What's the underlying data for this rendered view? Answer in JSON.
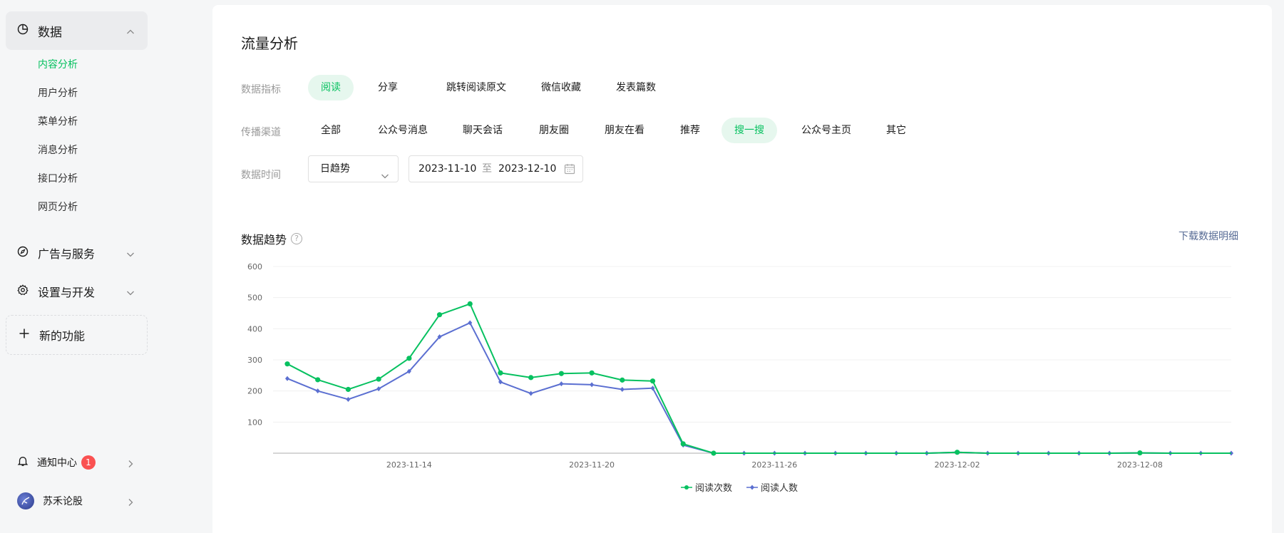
{
  "sidebar": {
    "data_label": "数据",
    "sub_items": [
      "内容分析",
      "用户分析",
      "菜单分析",
      "消息分析",
      "接口分析",
      "网页分析"
    ],
    "ads_label": "广告与服务",
    "settings_label": "设置与开发",
    "new_label": "新的功能",
    "notify_label": "通知中心",
    "notify_count": "1",
    "account_label": "苏禾论股"
  },
  "main": {
    "title": "流量分析",
    "metric_label": "数据指标",
    "metrics": [
      "阅读",
      "分享",
      "跳转阅读原文",
      "微信收藏",
      "发表篇数"
    ],
    "channel_label": "传播渠道",
    "channels": [
      "全部",
      "公众号消息",
      "聊天会话",
      "朋友圈",
      "朋友在看",
      "推荐",
      "搜一搜",
      "公众号主页",
      "其它"
    ],
    "time_label": "数据时间",
    "granularity": "日趋势",
    "date_start": "2023-11-10",
    "date_sep": "至",
    "date_end": "2023-12-10",
    "trend_title": "数据趋势",
    "help": "?",
    "download": "下载数据明细"
  },
  "colors": {
    "accent": "#07c160",
    "series2": "#5b6fd1",
    "link": "#576b95"
  },
  "chart_data": {
    "type": "line",
    "x": [
      "2023-11-10",
      "2023-11-11",
      "2023-11-12",
      "2023-11-13",
      "2023-11-14",
      "2023-11-15",
      "2023-11-16",
      "2023-11-17",
      "2023-11-18",
      "2023-11-19",
      "2023-11-20",
      "2023-11-21",
      "2023-11-22",
      "2023-11-23",
      "2023-11-24",
      "2023-11-25",
      "2023-11-26",
      "2023-11-27",
      "2023-11-28",
      "2023-11-29",
      "2023-11-30",
      "2023-12-01",
      "2023-12-02",
      "2023-12-03",
      "2023-12-04",
      "2023-12-05",
      "2023-12-06",
      "2023-12-07",
      "2023-12-08",
      "2023-12-09",
      "2023-12-10",
      "2023-12-11"
    ],
    "series": [
      {
        "name": "阅读次数",
        "values": [
          287,
          236,
          205,
          238,
          305,
          445,
          480,
          258,
          243,
          256,
          258,
          235,
          232,
          30,
          0,
          0,
          0,
          0,
          0,
          0,
          0,
          0,
          3,
          0,
          0,
          0,
          0,
          0,
          1,
          0,
          0,
          0
        ]
      },
      {
        "name": "阅读人数",
        "values": [
          240,
          200,
          173,
          207,
          263,
          374,
          419,
          229,
          192,
          223,
          220,
          205,
          209,
          26,
          0,
          0,
          0,
          0,
          0,
          0,
          0,
          0,
          3,
          0,
          0,
          0,
          0,
          0,
          1,
          0,
          0,
          0
        ]
      }
    ],
    "y_ticks": [
      100,
      200,
      300,
      400,
      500,
      600
    ],
    "x_ticks": [
      "2023-11-14",
      "2023-11-20",
      "2023-11-26",
      "2023-12-02",
      "2023-12-08"
    ],
    "ylim": [
      0,
      600
    ],
    "grid": true,
    "legend_position": "bottom-center"
  }
}
